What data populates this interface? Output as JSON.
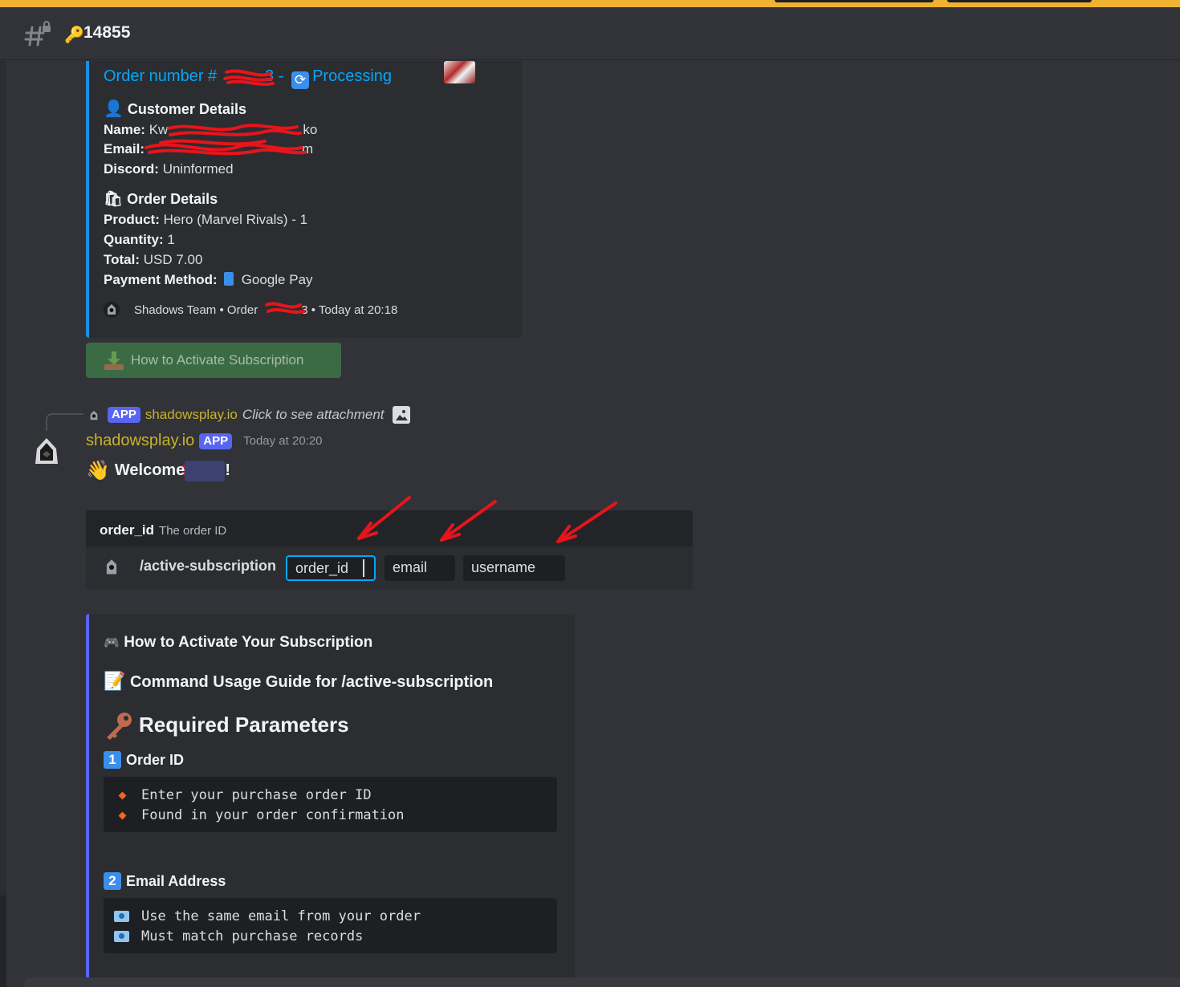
{
  "header": {
    "channel_icon": "hash-lock-icon",
    "key_emoji": "🔑",
    "channel_name": "14855"
  },
  "order_embed": {
    "title_prefix": "Order number #",
    "title_suffix": "3 -",
    "status": "Processing",
    "customer_heading": "Customer Details",
    "name_label": "Name:",
    "name_value_start": "Kw",
    "name_value_end": "ko",
    "email_label": "Email:",
    "email_value_end": "m",
    "discord_label": "Discord:",
    "discord_value": "Uninformed",
    "order_heading": "Order Details",
    "product_label": "Product:",
    "product_value": "Hero (Marvel Rivals) - 1",
    "quantity_label": "Quantity:",
    "quantity_value": "1",
    "total_label": "Total:",
    "total_value": "USD 7.00",
    "payment_label": "Payment Method:",
    "payment_value": "Google Pay",
    "footer_team": "Shadows Team • Order",
    "footer_tail": "3 • Today at 20:18"
  },
  "activate_button": {
    "label": "How to Activate Subscription"
  },
  "reply": {
    "app_tag": "APP",
    "author": "shadowsplay.io",
    "text": "Click to see attachment"
  },
  "message": {
    "author": "shadowsplay.io",
    "app_tag": "APP",
    "timestamp": "Today at 20:20",
    "welcome_wave": "👋",
    "welcome_text": "Welcome",
    "welcome_end": "!"
  },
  "command_preview": {
    "option_name": "order_id",
    "option_description": "The order ID",
    "command": "/active-subscription",
    "fields": [
      "order_id",
      "email",
      "username"
    ]
  },
  "guide_embed": {
    "title": "How to Activate Your Subscription",
    "subtitle": "Command Usage Guide for /active-subscription",
    "required_heading": "Required Parameters",
    "param1_num": "1",
    "param1_title": "Order ID",
    "param1_lines": [
      "Enter your purchase order ID",
      "Found in your order confirmation"
    ],
    "param2_num": "2",
    "param2_title": "Email Address",
    "param2_lines": [
      "Use the same email from your order",
      "Must match purchase records"
    ]
  },
  "colors": {
    "accent_blue": "#00a8fc",
    "app_tag": "#5865f2",
    "author_gold": "#c9b32a",
    "button_green": "#3b6b45",
    "annotation_red": "#e8141b"
  }
}
